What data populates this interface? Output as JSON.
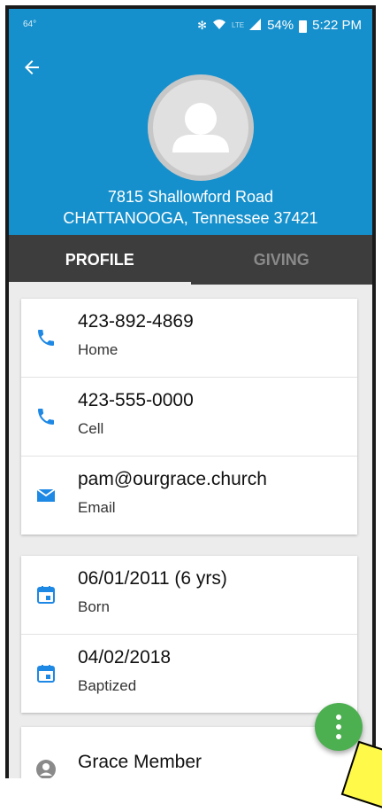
{
  "status_bar": {
    "temperature": "64°",
    "icons": [
      "bluetooth-icon",
      "wifi-icon",
      "lte-icon",
      "signal-icon"
    ],
    "battery": "54%",
    "time": "5:22 PM"
  },
  "header": {
    "address_line1": "7815 Shallowford Road",
    "address_line2": "CHATTANOOGA, Tennessee 37421",
    "back_icon": "arrow-left-icon",
    "avatar_icon": "person-silhouette-icon"
  },
  "tabs": [
    {
      "label": "PROFILE",
      "active": true
    },
    {
      "label": "GIVING",
      "active": false
    }
  ],
  "contacts": [
    {
      "value": "423-892-4869",
      "type": "Home",
      "icon": "phone-icon"
    },
    {
      "value": "423-555-0000",
      "type": "Cell",
      "icon": "phone-icon"
    },
    {
      "value": "pam@ourgrace.church",
      "type": "Email",
      "icon": "email-icon"
    }
  ],
  "dates": [
    {
      "value": "06/01/2011 (6 yrs)",
      "type": "Born",
      "icon": "calendar-icon"
    },
    {
      "value": "04/02/2018",
      "type": "Baptized",
      "icon": "calendar-icon"
    }
  ],
  "membership": {
    "value": "Grace Member",
    "icon": "person-circle-icon"
  },
  "fab": {
    "icon": "more-vertical-icon"
  },
  "colors": {
    "primary": "#1690cc",
    "tab_bar": "#3d3d3d",
    "icon_blue": "#1e88e5",
    "fab_green": "#4caf50",
    "background": "#ececec"
  }
}
